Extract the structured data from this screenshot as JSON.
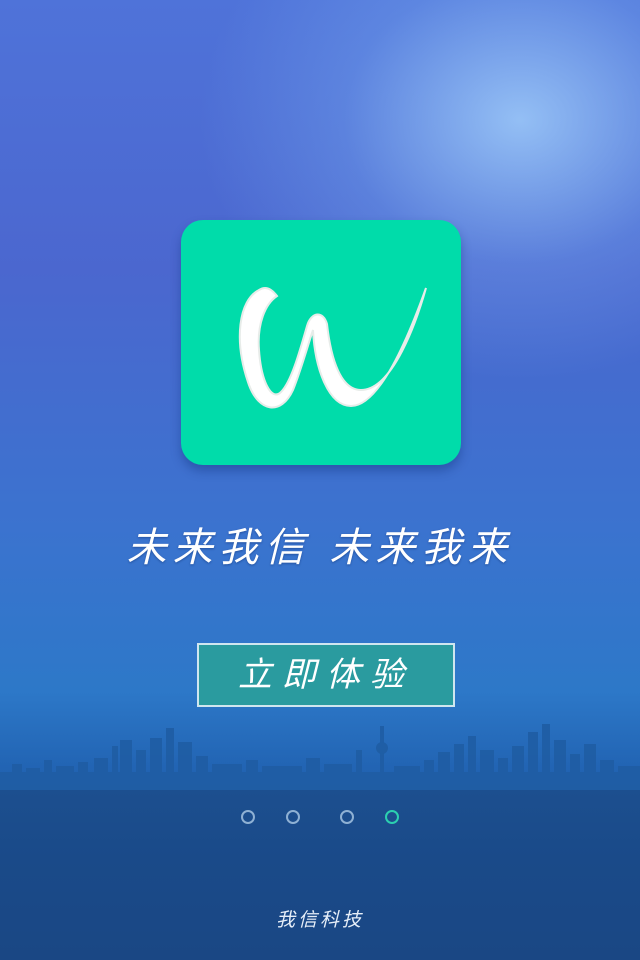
{
  "logo": {
    "icon": "w-letter-logo-icon",
    "color": "#00dcaa",
    "letter": "W"
  },
  "slogan": "未来我信 未来我来",
  "cta_label": "立即体验",
  "pager": {
    "count": 4,
    "active_index": 4
  },
  "footer_text": "我信科技",
  "colors": {
    "background_top": "#4f73d9",
    "background_bottom": "#1a4784",
    "button_fill": "#2a9b9f",
    "active_dot": "#2ccfb0"
  }
}
